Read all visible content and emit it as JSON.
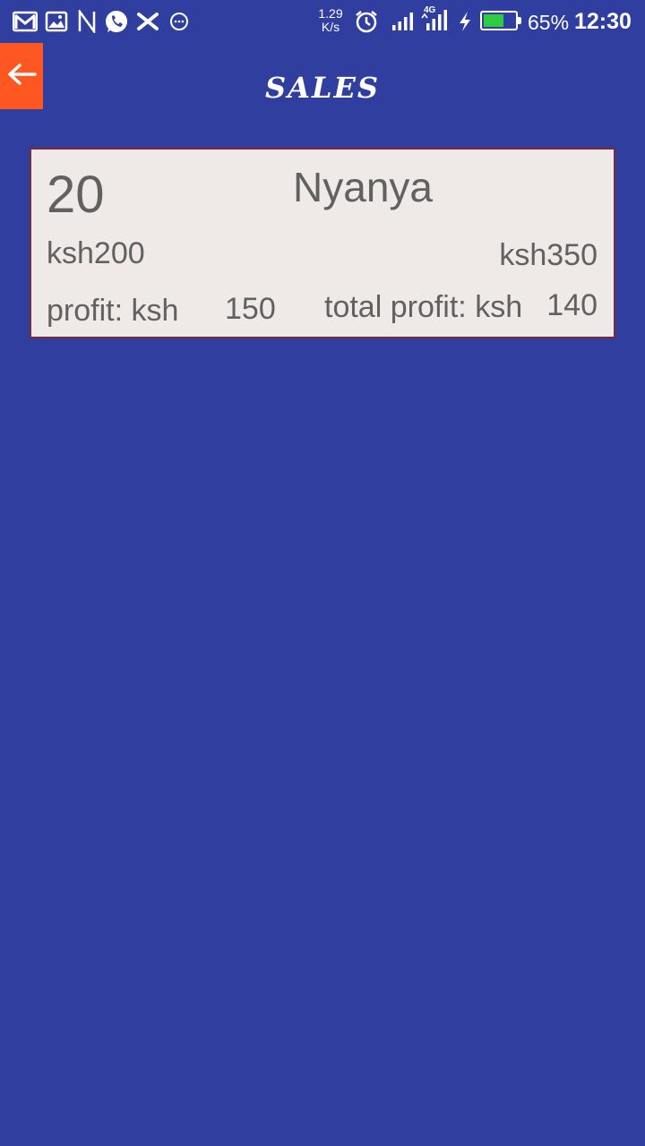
{
  "status_bar": {
    "notification_icons": [
      "gmail-icon",
      "gallery-icon",
      "n-app-icon",
      "whatsapp-icon",
      "x-app-icon",
      "more-notifications-icon"
    ],
    "net_speed_value": "1.29",
    "net_speed_unit": "K/s",
    "network_type": "4G",
    "battery_level_percent": 65,
    "battery_percent": "65%",
    "time": "12:30",
    "battery_color": "#2ecc40"
  },
  "toolbar": {
    "back_icon": "arrow-left-icon",
    "title": "SALES",
    "back_button_color": "#ff5722"
  },
  "sales": [
    {
      "quantity": "20",
      "product_name": "Nyanya",
      "buying_price": "ksh200",
      "selling_price": "ksh350",
      "profit_label": "profit: ksh",
      "profit_value": "150",
      "total_profit_label": "total profit: ksh",
      "total_profit_value": "140"
    }
  ],
  "colors": {
    "background": "#303f9f",
    "card_background": "#efe9e7",
    "card_border": "#7b2c3c",
    "card_text": "#616161"
  }
}
